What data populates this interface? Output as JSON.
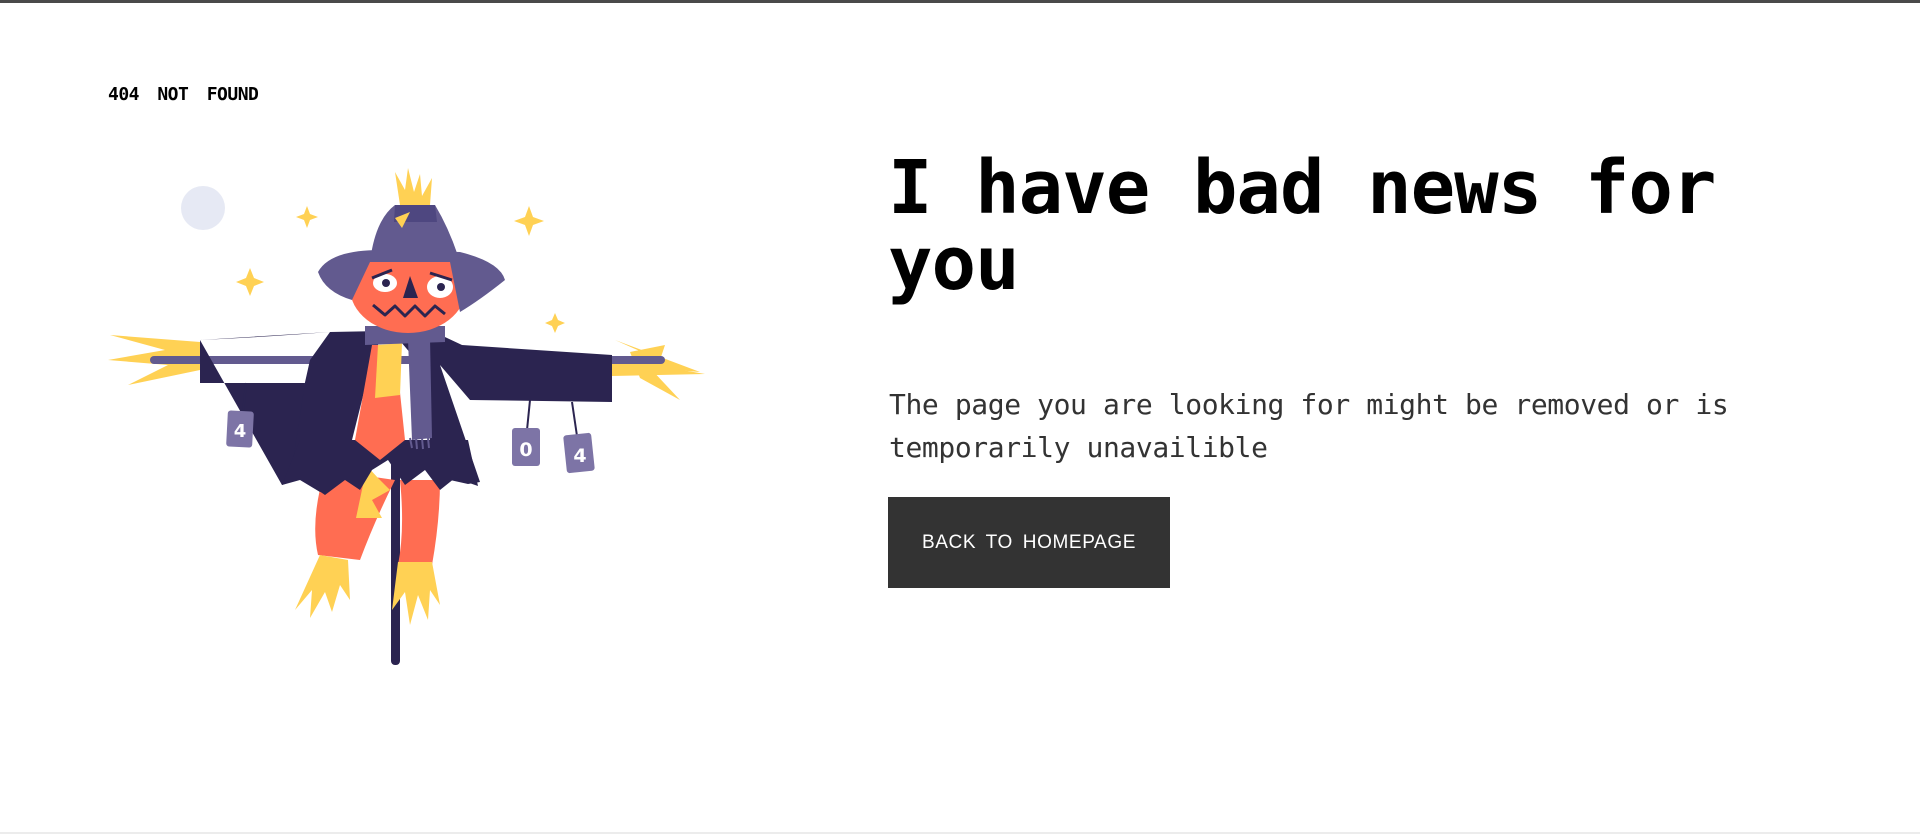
{
  "header": {
    "brand_label": "404 NOT FOUND"
  },
  "main": {
    "headline": "I have bad news for you",
    "message": "The page you are looking for might be removed or is temporarily unavailible",
    "cta_label": "BACK TO HOMEPAGE"
  },
  "illustration": {
    "subject": "scarecrow",
    "can_labels": [
      "4",
      "0",
      "4"
    ]
  },
  "colors": {
    "text": "#000000",
    "body_text": "#333333",
    "button_bg": "#333333",
    "button_text": "#ffffff",
    "coat": "#2b2450",
    "hat": "#625a8f",
    "pumpkin": "#ff6d52",
    "straw": "#ffd154",
    "can": "#7d74a6",
    "moon": "#e6e9f4"
  }
}
